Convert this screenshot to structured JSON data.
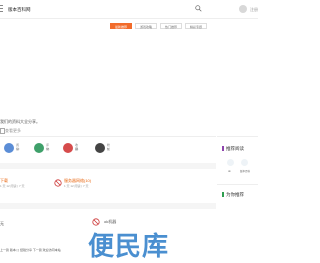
{
  "header": {
    "brand": "版本百科网",
    "login": "注册"
  },
  "tabs": [
    {
      "label": "最新推荐",
      "active": true
    },
    {
      "label": "游戏攻略",
      "active": false
    },
    {
      "label": "热门推荐",
      "active": false
    },
    {
      "label": "精彩专题",
      "active": false
    }
  ],
  "intro": "我们的资料大全分享。",
  "section_link": "查看更多",
  "stats": [
    {
      "label": "阅读",
      "value": "10",
      "color": "#5b8dd6"
    },
    {
      "label": "评论",
      "value": "98",
      "color": "#3fa06a"
    },
    {
      "label": "收藏",
      "value": "36",
      "color": "#d64b4b"
    },
    {
      "label": "粉丝",
      "value": "5",
      "color": "#444444"
    }
  ],
  "list": [
    {
      "title": "下载",
      "meta": "1 天 12 阅读 | 7 天"
    },
    {
      "title": "服务器网络",
      "count": "(10)",
      "meta": "1 天 12 阅读 | 7 天"
    }
  ],
  "list2": [
    {
      "title": "无",
      "meta": ""
    },
    {
      "title": "ok机器",
      "meta": ""
    }
  ],
  "sidebar": {
    "recommended": "推荐阅读",
    "items": [
      "ok",
      "ok",
      "版本百科"
    ],
    "featured": "为你推荐"
  },
  "watermark": "便民库",
  "footer": "上一篇 版本 [ ] 经验分享 下一篇 欢迎访问本站"
}
